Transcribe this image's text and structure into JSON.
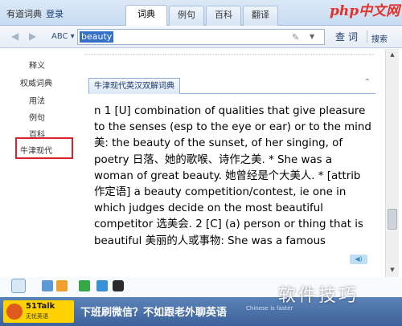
{
  "window": {
    "app_title": "有道词典",
    "login": "登录"
  },
  "tabs": [
    {
      "label": "词典",
      "active": true
    },
    {
      "label": "例句",
      "active": false
    },
    {
      "label": "百科",
      "active": false
    },
    {
      "label": "翻译",
      "active": false
    }
  ],
  "logo_text": "php中文网",
  "toolbar": {
    "back_icon": "left-arrow-icon",
    "forward_icon": "right-arrow-icon",
    "abc_label": "ABC ▾",
    "query": "beauty",
    "lookup_label": "查词",
    "search_label": "搜索"
  },
  "sidebar": {
    "items": [
      {
        "label": "释义"
      },
      {
        "label": "权威词典"
      },
      {
        "label": "用法"
      },
      {
        "label": "例句"
      },
      {
        "label": "百科"
      },
      {
        "label": "牛津现代"
      }
    ],
    "highlight_color": "#d9232c"
  },
  "section": {
    "title": "牛津现代英汉双解词典",
    "lines": [
      "n 1 [U] combination of qualities that give pleasure",
      "to the senses (esp to the eye or ear) or to the mind",
      "美: the beauty of the sunset, of her singing, of",
      "poetry 日落、她的歌喉、诗作之美. * She was a",
      "woman of great beauty. 她曾经是个大美人. * [attrib",
      "作定语] a beauty competition/contest, ie one in",
      "which judges decide on the most beautiful",
      "competitor 选美会. 2 [C] (a) person or thing that is",
      "beautiful 美丽的人或事物: She was a famous"
    ]
  },
  "ad": {
    "logo_main": "51Talk",
    "logo_sub": "无忧英语",
    "text": "下班刷微信？不如跟老外聊英语",
    "small": "Chinese is faster"
  },
  "watermark": "软件技巧",
  "colors": {
    "accent": "#3470c8",
    "ad_bg": "#3c6299",
    "logo_red": "#e0322b"
  }
}
